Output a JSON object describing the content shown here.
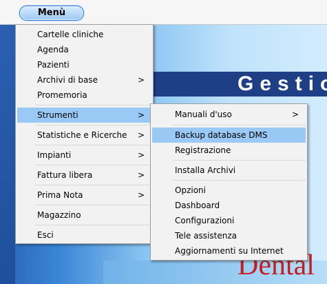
{
  "topbar": {
    "menu_label": "Menù"
  },
  "app": {
    "title": "Gestio",
    "brand": "Dental"
  },
  "menu": {
    "items": [
      "Cartelle cliniche",
      "Agenda",
      "Pazienti",
      "Archivi di base",
      "Promemoria",
      "Strumenti",
      "Statistiche e Ricerche",
      "Impianti",
      "Fattura libera",
      "Prima Nota",
      "Magazzino",
      "Esci"
    ],
    "submenu_arrow": ">"
  },
  "submenu": {
    "items": [
      "Manuali d'uso",
      "Backup database DMS",
      "Registrazione",
      "Installa Archivi",
      "Opzioni",
      "Dashboard",
      "Configurazioni",
      "Tele assistenza",
      "Aggiornamenti su Internet"
    ]
  }
}
